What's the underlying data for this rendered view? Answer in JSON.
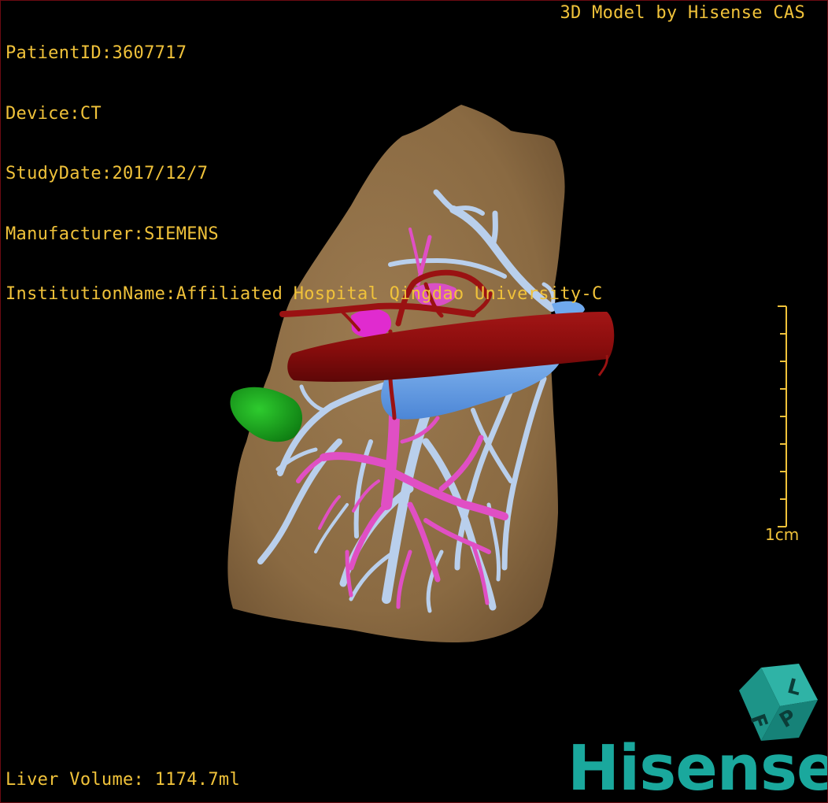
{
  "overlay": {
    "patient_id": "PatientID:3607717",
    "device": "Device:CT",
    "study_date": "StudyDate:2017/12/7",
    "manufacturer": "Manufacturer:SIEMENS",
    "institution": "InstitutionName:Affiliated Hospital Qingdao University-C",
    "credit": "3D Model by Hisense CAS",
    "liver_volume": "Liver Volume: 1174.7ml"
  },
  "scale_bar": {
    "label": "1cm"
  },
  "orientation_cube": {
    "icon": "orientation-cube-icon",
    "faces": [
      "L",
      "P",
      "F"
    ]
  },
  "logo": {
    "text": "Hisense"
  },
  "colors": {
    "overlay_text": "#f0c23a",
    "liver": "#8e6c43",
    "hepatic_vein": "#b9cfec",
    "portal_vein": "#e04fc4",
    "vena_cava": "#6aa3e8",
    "aorta": "#8a0d0d",
    "gallbladder": "#14a81a",
    "logo": "#1aa89d"
  }
}
